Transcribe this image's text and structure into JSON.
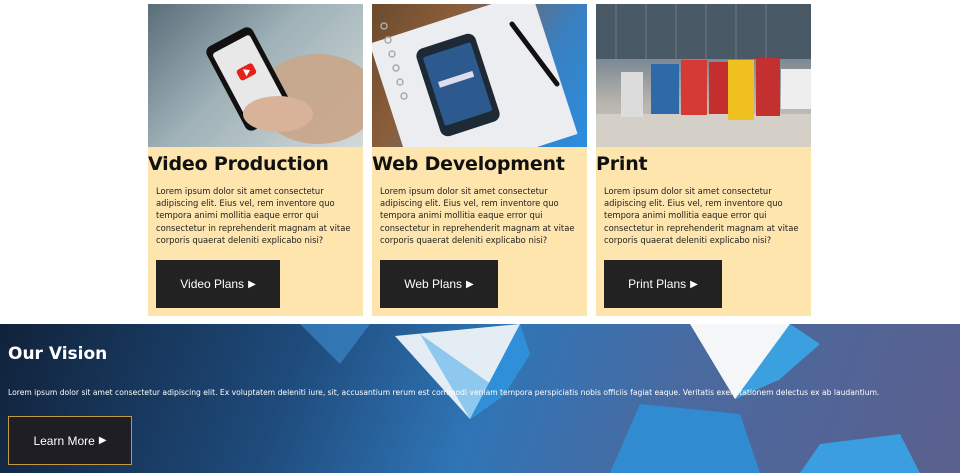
{
  "cards": [
    {
      "title": "Video Production",
      "text": "Lorem ipsum dolor sit amet consectetur adipiscing elit. Eius vel, rem inventore quo tempora animi mollitia eaque error qui consectetur in reprehenderit magnam at vitae corporis quaerat deleniti explicabo nisi?",
      "button_label": "Video Plans"
    },
    {
      "title": "Web Development",
      "text": "Lorem ipsum dolor sit amet consectetur adipiscing elit. Eius vel, rem inventore quo tempora animi mollitia eaque error qui consectetur in reprehenderit magnam at vitae corporis quaerat deleniti explicabo nisi?",
      "button_label": "Web Plans"
    },
    {
      "title": "Print",
      "text": "Lorem ipsum dolor sit amet consectetur adipiscing elit. Eius vel, rem inventore quo tempora animi mollitia eaque error qui consectetur in reprehenderit magnam at vitae corporis quaerat deleniti explicabo nisi?",
      "button_label": "Print Plans"
    }
  ],
  "vision": {
    "title": "Our Vision",
    "text": "Lorem ipsum dolor sit amet consectetur adipiscing elit. Ex voluptatem deleniti iure, sit, accusantium rerum est commodi veniam tempora perspiciatis nobis officiis fagiat eaque. Veritatis exercitationem delectus ex ab laudantium.",
    "button_label": "Learn More"
  },
  "icons": {
    "button_arrow": "play-triangle-icon"
  },
  "colors": {
    "card_bg": "#fde5ad",
    "button_bg": "#222222",
    "vision_button_border": "#c59a3d"
  }
}
